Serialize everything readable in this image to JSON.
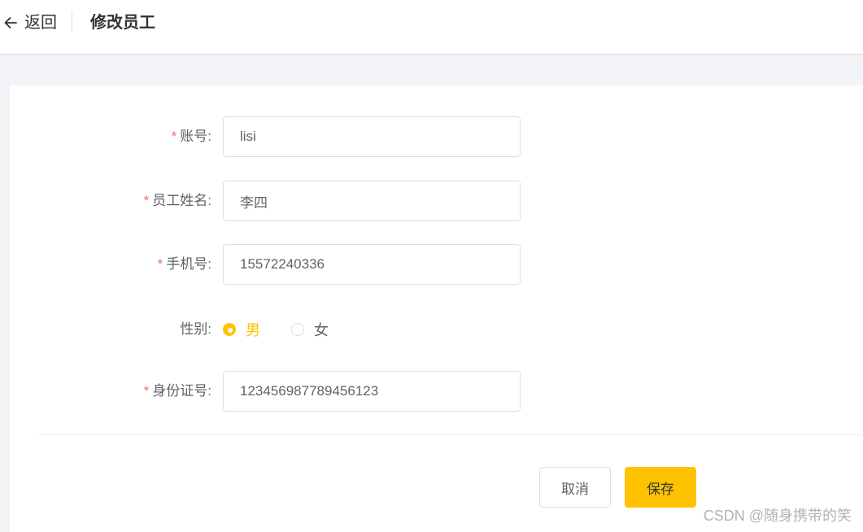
{
  "header": {
    "back_label": "返回",
    "title": "修改员工"
  },
  "form": {
    "required_mark": "*",
    "account": {
      "label": "账号:",
      "value": "lisi"
    },
    "name": {
      "label": "员工姓名:",
      "value": "李四"
    },
    "phone": {
      "label": "手机号:",
      "value": "15572240336"
    },
    "gender": {
      "label": "性别:",
      "options": [
        {
          "label": "男",
          "checked": true
        },
        {
          "label": "女",
          "checked": false
        }
      ]
    },
    "id_number": {
      "label": "身份证号:",
      "value": "123456987789456123"
    }
  },
  "actions": {
    "cancel_label": "取消",
    "save_label": "保存"
  },
  "watermark": "CSDN @随身携带的笑",
  "colors": {
    "accent": "#ffc200",
    "required": "#f56c6c",
    "background": "#f3f4f7"
  },
  "icons": {
    "back": "arrow-left-icon"
  }
}
